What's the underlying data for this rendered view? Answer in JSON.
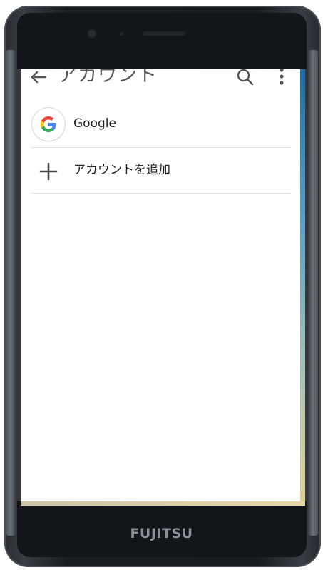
{
  "device": {
    "brand": "FUJITSU"
  },
  "appbar": {
    "title": "アカウント",
    "back_icon": "arrow-back-icon",
    "search_icon": "search-icon",
    "more_icon": "more-vert-icon"
  },
  "accounts": [
    {
      "label": "Google",
      "icon": "google-logo-icon"
    }
  ],
  "add_account": {
    "label": "アカウントを追加",
    "icon": "plus-icon"
  },
  "colors": {
    "text_primary": "#222222",
    "title": "#5a5a5a",
    "divider": "#e3e3e3",
    "google_blue": "#4285F4",
    "google_red": "#EA4335",
    "google_yellow": "#FBBC05",
    "google_green": "#34A853"
  }
}
